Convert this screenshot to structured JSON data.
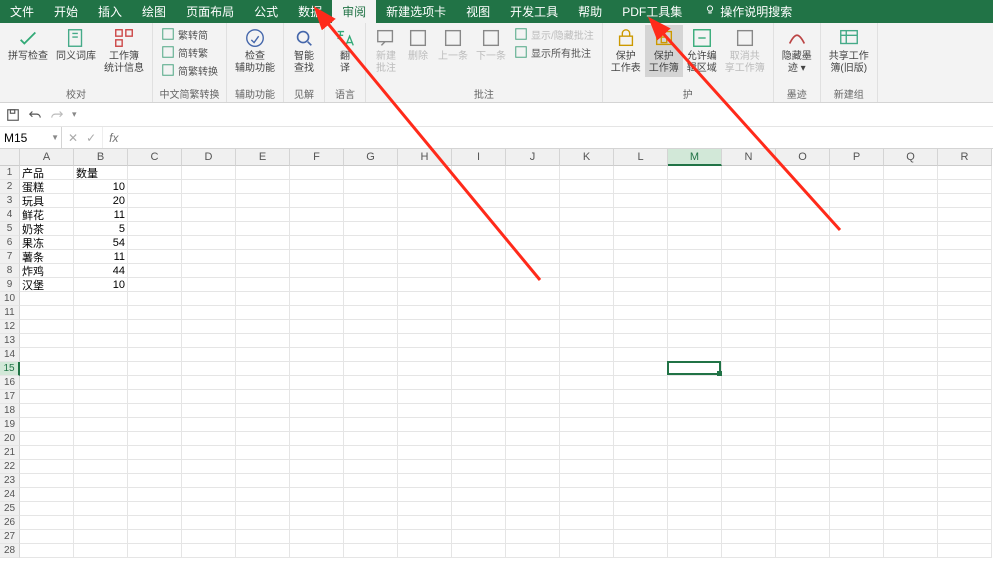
{
  "menubar": {
    "tabs": [
      "文件",
      "开始",
      "插入",
      "绘图",
      "页面布局",
      "公式",
      "数据",
      "审阅",
      "新建选项卡",
      "视图",
      "开发工具",
      "帮助",
      "PDF工具集"
    ],
    "active_index": 7,
    "search_label": "操作说明搜索"
  },
  "ribbon": {
    "groups": [
      {
        "title": "校对",
        "items": [
          {
            "type": "big",
            "label": "拼写检查"
          },
          {
            "type": "big",
            "label": "同义词库"
          },
          {
            "type": "big",
            "label": "工作簿\n统计信息"
          }
        ]
      },
      {
        "title": "中文简繁转换",
        "items": [
          {
            "type": "small",
            "label": "繁转简"
          },
          {
            "type": "small",
            "label": "简转繁"
          },
          {
            "type": "small",
            "label": "简繁转换"
          }
        ]
      },
      {
        "title": "辅助功能",
        "items": [
          {
            "type": "big",
            "label": "检查\n辅助功能"
          }
        ]
      },
      {
        "title": "见解",
        "items": [
          {
            "type": "big",
            "label": "智能\n查找"
          }
        ]
      },
      {
        "title": "语言",
        "items": [
          {
            "type": "big",
            "label": "翻\n译"
          }
        ]
      },
      {
        "title": "批注",
        "items": [
          {
            "type": "big",
            "label": "新建\n批注",
            "disabled": true
          },
          {
            "type": "big",
            "label": "删除",
            "disabled": true
          },
          {
            "type": "big",
            "label": "上一条",
            "disabled": true
          },
          {
            "type": "big",
            "label": "下一条",
            "disabled": true
          },
          {
            "type": "small",
            "label": "显示/隐藏批注",
            "disabled": true
          },
          {
            "type": "small",
            "label": "显示所有批注"
          }
        ]
      },
      {
        "title": "护",
        "items": [
          {
            "type": "big",
            "label": "保护\n工作表"
          },
          {
            "type": "big",
            "label": "保护\n工作簿",
            "highlight": true
          },
          {
            "type": "big",
            "label": "允许编\n辑区域"
          },
          {
            "type": "big",
            "label": "取消共\n享工作簿",
            "disabled": true
          }
        ]
      },
      {
        "title": "墨迹",
        "items": [
          {
            "type": "big",
            "label": "隐藏墨\n迹 ▾"
          }
        ]
      },
      {
        "title": "新建组",
        "items": [
          {
            "type": "big",
            "label": "共享工作\n簿(旧版)"
          }
        ]
      }
    ]
  },
  "name_box": "M15",
  "columns": [
    "A",
    "B",
    "C",
    "D",
    "E",
    "F",
    "G",
    "H",
    "I",
    "J",
    "K",
    "L",
    "M",
    "N",
    "O",
    "P",
    "Q",
    "R"
  ],
  "active_col_index": 12,
  "chart_data": {
    "type": "table",
    "headers": [
      "产品",
      "数量"
    ],
    "rows": [
      [
        "蛋糕",
        10
      ],
      [
        "玩具",
        20
      ],
      [
        "鲜花",
        11
      ],
      [
        "奶茶",
        5
      ],
      [
        "果冻",
        54
      ],
      [
        "薯条",
        11
      ],
      [
        "炸鸡",
        44
      ],
      [
        "汉堡",
        10
      ]
    ]
  },
  "row_count": 28,
  "active_row": 15
}
